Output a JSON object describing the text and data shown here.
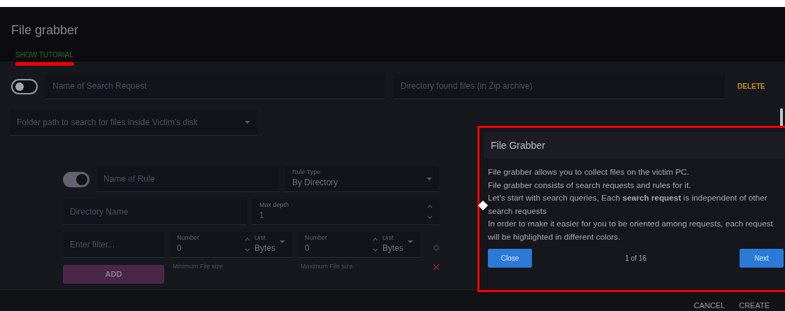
{
  "dialog": {
    "title": "File grabber",
    "tutorial_link": "SHOW TUTORIAL"
  },
  "search_request": {
    "enabled": false,
    "name_placeholder": "Name of Search Request",
    "directory_placeholder": "Directory found files (in Zip archive)",
    "delete": "DELETE",
    "folder_placeholder": "Folder path to search for files inside Victim's disk"
  },
  "rule": {
    "enabled": true,
    "name_placeholder": "Name of Rule",
    "rule_type": {
      "label": "Rule Type",
      "value": "By Directory"
    },
    "directory_placeholder": "Directory Name",
    "max_depth": {
      "label": "Max depth",
      "value": "1"
    },
    "filter_placeholder": "Enter filter...",
    "add": "ADD",
    "sizes": [
      {
        "number_label": "Number",
        "value": "0",
        "unit_label": "Unit",
        "unit": "Bytes",
        "hint": "Minimum File size"
      },
      {
        "number_label": "Number",
        "value": "0",
        "unit_label": "Unit",
        "unit": "Bytes",
        "hint": "Maximum File size"
      }
    ]
  },
  "tour": {
    "title": "File Grabber",
    "lines": [
      "File grabber allows you to collect files on the victim PC.",
      "File grabber consists of search requests and rules for it.",
      "Let's start with search queries, Each **search request** is independent of other search requests",
      "In order to make it easier for you to be oriented among requests, each request will be highlighted in different colors."
    ],
    "close": "Close",
    "progress": "1 of 16",
    "next": "Next"
  },
  "footer": {
    "buttons": [
      "CANCEL",
      "CREATE"
    ]
  }
}
